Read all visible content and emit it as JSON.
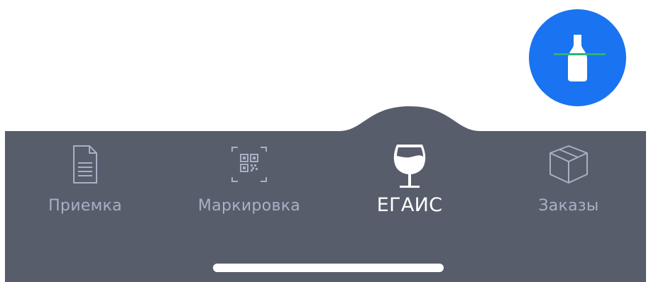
{
  "fab": {
    "icon": "bottle-scan-icon",
    "color": "#1a73f0",
    "scan_line_color": "#2bb673"
  },
  "tabbar": {
    "background": "#585d6c",
    "tabs": [
      {
        "label": "Приемка",
        "icon": "document-icon",
        "active": false
      },
      {
        "label": "Маркировка",
        "icon": "qr-code-icon",
        "active": false
      },
      {
        "label": "ЕГАИС",
        "icon": "wine-glass-icon",
        "active": true
      },
      {
        "label": "Заказы",
        "icon": "box-icon",
        "active": false
      }
    ]
  }
}
